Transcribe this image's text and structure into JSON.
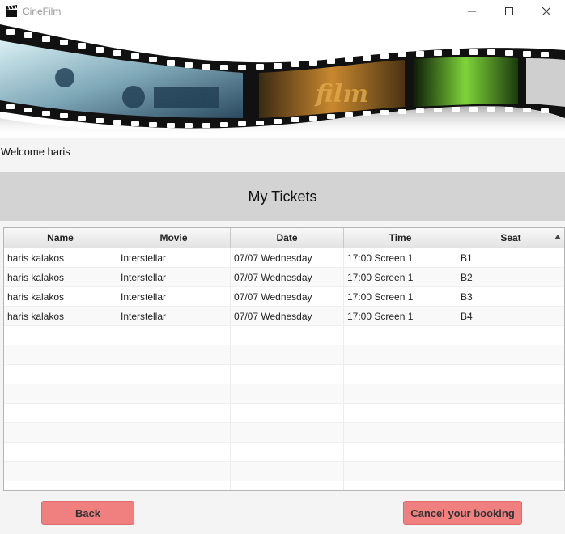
{
  "window": {
    "title": "CineFilm",
    "app_icon": "clapperboard-icon",
    "controls": [
      "minimize-icon",
      "maximize-icon",
      "close-icon"
    ]
  },
  "banner": {
    "text": "film"
  },
  "welcome": {
    "text": "Welcome haris"
  },
  "tickets": {
    "title": "My Tickets",
    "columns": [
      "Name",
      "Movie",
      "Date",
      "Time",
      "Seat"
    ],
    "sort": {
      "column": "Seat",
      "direction": "ascending"
    },
    "rows": [
      [
        "haris kalakos",
        "Interstellar",
        "07/07 Wednesday",
        "17:00 Screen 1",
        "B1"
      ],
      [
        "haris kalakos",
        "Interstellar",
        "07/07 Wednesday",
        "17:00 Screen 1",
        "B2"
      ],
      [
        "haris kalakos",
        "Interstellar",
        "07/07 Wednesday",
        "17:00 Screen 1",
        "B3"
      ],
      [
        "haris kalakos",
        "Interstellar",
        "07/07 Wednesday",
        "17:00 Screen 1",
        "B4"
      ]
    ]
  },
  "buttons": {
    "back": "Back",
    "cancel": "Cancel your booking"
  },
  "colors": {
    "button_bg": "#f08080",
    "header_bg": "#d3d3d3"
  }
}
